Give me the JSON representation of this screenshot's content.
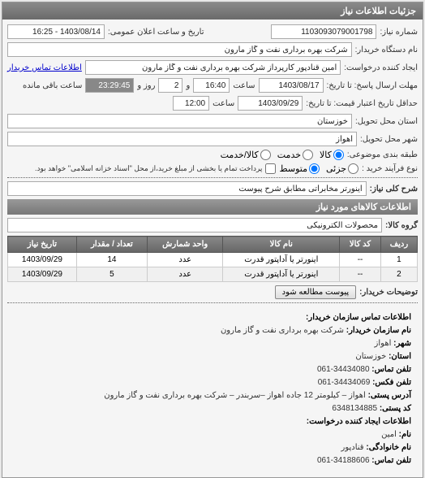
{
  "panel_title": "جزئیات اطلاعات نیاز",
  "fields": {
    "need_no_label": "شماره نیاز:",
    "need_no": "1103093079001798",
    "announce_label": "تاریخ و ساعت اعلان عمومی:",
    "announce_value": "1403/08/14 - 16:25",
    "buyer_org_label": "نام دستگاه خریدار:",
    "buyer_org": "شرکت بهره برداری نفت و گاز مارون",
    "requester_label": "ایجاد کننده درخواست:",
    "requester": "امین قنادپور کارپرداز شرکت بهره برداری نفت و گاز مارون",
    "contact_link": "اطلاعات تماس خریدار",
    "deadline_label": "مهلت ارسال پاسخ: تا تاریخ:",
    "deadline_date": "1403/08/17",
    "time_label": "ساعت",
    "deadline_time": "16:40",
    "and_label": "و",
    "days_value": "2",
    "days_label": "روز و",
    "remain_time": "23:29:45",
    "remain_label": "ساعت باقی مانده",
    "validity_label": "حداقل تاریخ اعتبار قیمت: تا تاریخ:",
    "validity_date": "1403/09/29",
    "validity_time": "12:00",
    "province_label": "استان محل تحویل:",
    "province": "خوزستان",
    "city_label": "شهر محل تحویل:",
    "city": "اهواز",
    "subject_type_label": "طبقه بندی موضوعی:",
    "radio_goods": "کالا",
    "radio_service": "خدمت",
    "radio_goods_service": "کالا/خدمت",
    "process_label": "نوع فرآیند خرید :",
    "radio_small": "جزئی",
    "radio_medium": "متوسط",
    "process_note": "پرداخت تمام یا بخشی از مبلغ خرید،از محل \"اسناد خزانه اسلامی\" خواهد بود.",
    "desc_label": "شرح کلی نیاز:",
    "desc_value": "اینورتر مخابراتی مطابق شرح پیوست",
    "group_label": "گروه کالا:",
    "group_value": "محصولات الکترونیکی",
    "buyer_notes_label": "توضیحات خریدار:",
    "attach_btn": "پیوست مطالعه شود"
  },
  "items_title": "اطلاعات کالاهای مورد نیاز",
  "table": {
    "headers": [
      "ردیف",
      "کد کالا",
      "نام کالا",
      "واحد شمارش",
      "تعداد / مقدار",
      "تاریخ نیاز"
    ],
    "rows": [
      [
        "1",
        "--",
        "اینورتر یا آداپتور قدرت",
        "عدد",
        "14",
        "1403/09/29"
      ],
      [
        "2",
        "--",
        "اینورتر یا آداپتور قدرت",
        "عدد",
        "5",
        "1403/09/29"
      ]
    ]
  },
  "contact": {
    "heading": "اطلاعات تماس سازمان خریدار:",
    "org_label": "نام سازمان خریدار:",
    "org": "شرکت بهره برداری نفت و گاز مارون",
    "city_label": "شهر:",
    "city": "اهواز",
    "province_label": "استان:",
    "province": "خوزستان",
    "phone_label": "تلفن تماس:",
    "phone": "34434080-061",
    "fax_label": "تلفن فکس:",
    "fax": "34434069-061",
    "address_label": "آدرس پستی:",
    "address": "اهواز – کیلومتر 12 جاده اهواز –سربندر – شرکت بهره برداری نفت و گاز مارون",
    "postal_label": "کد پستی:",
    "postal": "6348134885",
    "heading2": "اطلاعات ایجاد کننده درخواست:",
    "fname_label": "نام:",
    "fname": "امین",
    "lname_label": "نام خانوادگی:",
    "lname": "قنادپور",
    "cphone_label": "تلفن تماس:",
    "cphone": "34188606-061"
  }
}
